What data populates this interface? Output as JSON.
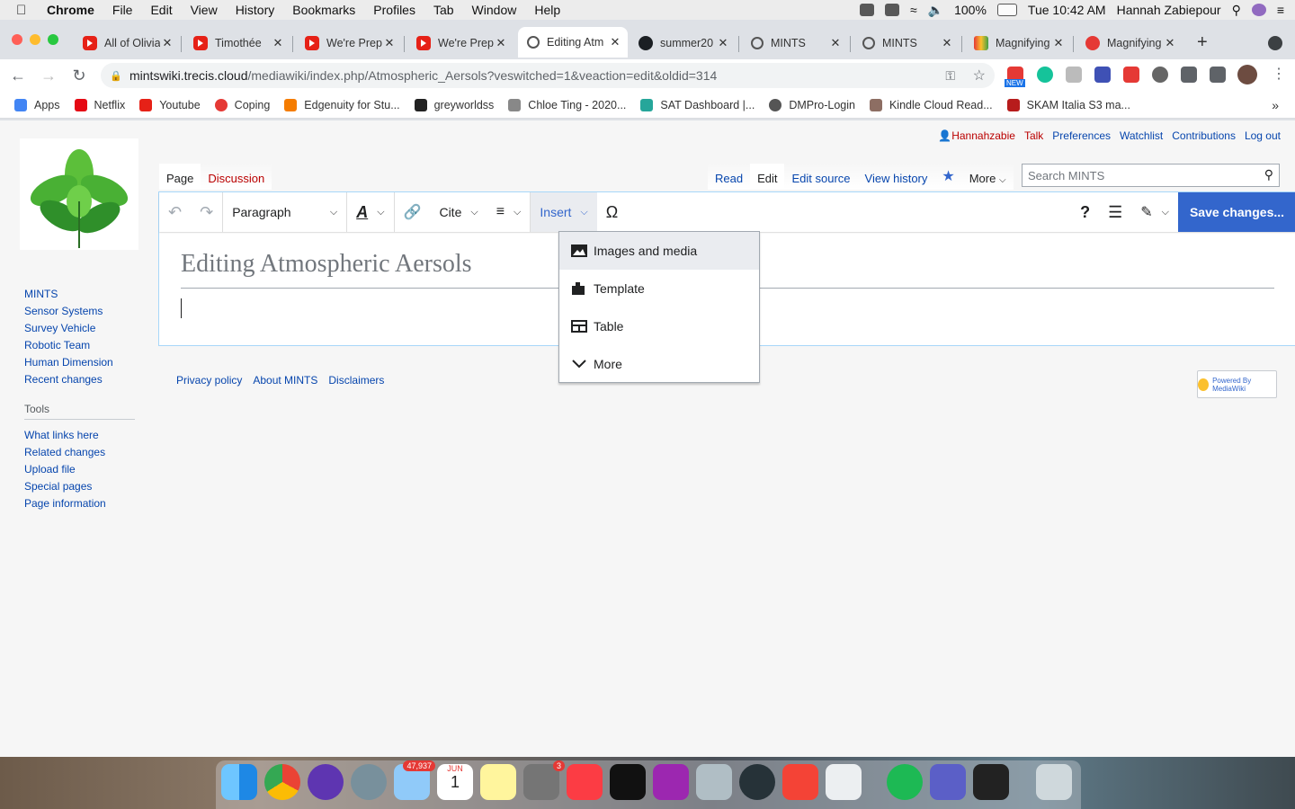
{
  "menubar": {
    "app_name": "Chrome",
    "items": [
      "File",
      "Edit",
      "View",
      "History",
      "Bookmarks",
      "Profiles",
      "Tab",
      "Window",
      "Help"
    ],
    "battery": "100%",
    "clock": "Tue 10:42 AM",
    "user": "Hannah Zabiepour"
  },
  "browser": {
    "tabs": [
      {
        "title": "All of Olivia",
        "icon": "youtube-icon"
      },
      {
        "title": "Timothée",
        "icon": "youtube-icon"
      },
      {
        "title": "We're Prep",
        "icon": "youtube-icon"
      },
      {
        "title": "We're Prep",
        "icon": "youtube-icon"
      },
      {
        "title": "Editing Atm",
        "icon": "globe-icon",
        "active": true
      },
      {
        "title": "summer20",
        "icon": "github-icon"
      },
      {
        "title": "MINTS",
        "icon": "globe-icon"
      },
      {
        "title": "MINTS",
        "icon": "globe-icon"
      },
      {
        "title": "Magnifying",
        "icon": "magnify-icon"
      },
      {
        "title": "Magnifying",
        "icon": "red-circle-icon"
      }
    ],
    "url_host": "mintswiki.trecis.cloud",
    "url_path": "/mediawiki/index.php/Atmospheric_Aersols?veswitched=1&veaction=edit&oldid=314",
    "ext_badge": "NEW",
    "bookmarks": [
      {
        "label": "Apps",
        "color": "#4285f4"
      },
      {
        "label": "Netflix",
        "color": "#e50914"
      },
      {
        "label": "Youtube",
        "color": "#e62117"
      },
      {
        "label": "Coping",
        "color": "#e53935"
      },
      {
        "label": "Edgenuity for Stu...",
        "color": "#f57c00"
      },
      {
        "label": "greyworldss",
        "color": "#222"
      },
      {
        "label": "Chloe Ting - 2020...",
        "color": "#888"
      },
      {
        "label": "SAT Dashboard |...",
        "color": "#26a69a"
      },
      {
        "label": "DMPro-Login",
        "color": "#555"
      },
      {
        "label": "Kindle Cloud Read...",
        "color": "#8d6e63"
      },
      {
        "label": "SKAM Italia S3 ma...",
        "color": "#b71c1c"
      }
    ]
  },
  "wiki": {
    "personal": {
      "user": "Hannahzabie",
      "talk": "Talk",
      "preferences": "Preferences",
      "watchlist": "Watchlist",
      "contributions": "Contributions",
      "logout": "Log out"
    },
    "page_tab": "Page",
    "discussion_tab": "Discussion",
    "views": {
      "read": "Read",
      "edit": "Edit",
      "edit_source": "Edit source",
      "history": "View history",
      "more": "More"
    },
    "search_placeholder": "Search MINTS",
    "sidebar": [
      "MINTS",
      "Sensor Systems",
      "Survey Vehicle",
      "Robotic Team",
      "Human Dimension",
      "Recent changes"
    ],
    "tools_header": "Tools",
    "tools": [
      "What links here",
      "Related changes",
      "Upload file",
      "Special pages",
      "Page information"
    ],
    "editor": {
      "paragraph": "Paragraph",
      "cite": "Cite",
      "insert": "Insert",
      "save": "Save changes...",
      "heading": "Editing Atmospheric Aersols"
    },
    "insert_menu": [
      "Images and media",
      "Template",
      "Table",
      "More"
    ],
    "footer": [
      "Privacy policy",
      "About MINTS",
      "Disclaimers"
    ],
    "powered_by": "Powered By MediaWiki"
  },
  "dock": {
    "mail_badge": "47,937",
    "calendar_month": "JUN",
    "calendar_day": "1",
    "prefs_badge": "3"
  }
}
